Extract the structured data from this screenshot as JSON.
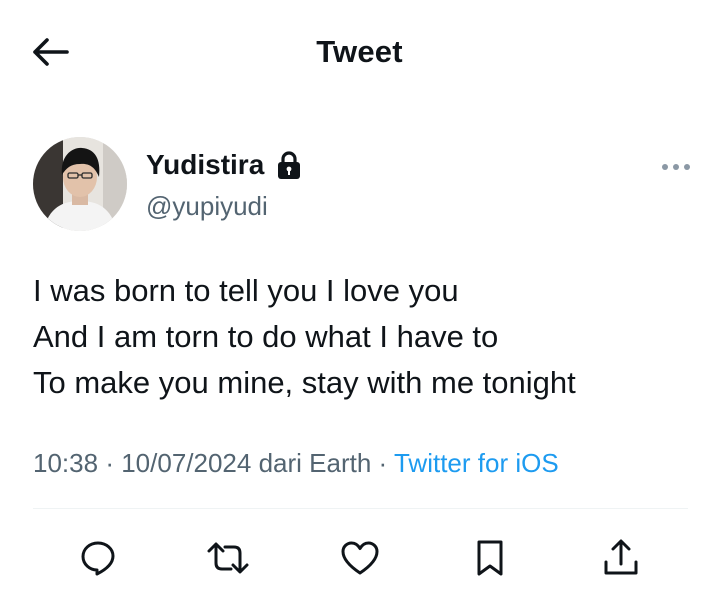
{
  "header": {
    "title": "Tweet"
  },
  "author": {
    "name": "Yudistira",
    "handle": "@yupiyudi"
  },
  "tweet": {
    "lines": [
      "I was born to tell you I love you",
      "And I am torn to do what I have to",
      "To make you mine, stay with me tonight"
    ],
    "time": "10:38",
    "separator": "·",
    "date_location": "10/07/2024 dari Earth",
    "source": "Twitter for iOS"
  },
  "icons": {
    "back": "arrow-left-icon",
    "lock": "lock-icon",
    "more": "more-horizontal-icon",
    "reply": "reply-icon",
    "retweet": "retweet-icon",
    "like": "heart-icon",
    "bookmark": "bookmark-icon",
    "share": "share-icon"
  },
  "colors": {
    "text": "#0f1419",
    "secondary": "#536471",
    "accent": "#1d9bf0",
    "divider": "#eff3f4"
  }
}
